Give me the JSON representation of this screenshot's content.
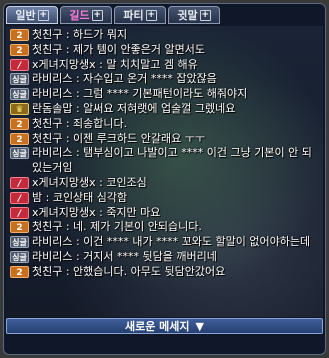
{
  "tabs": [
    {
      "label": "일반",
      "plus": "+"
    },
    {
      "label": "길드",
      "plus": "+"
    },
    {
      "label": "파티",
      "plus": "+"
    },
    {
      "label": "귓말",
      "plus": "+"
    }
  ],
  "messages": [
    {
      "badge": "2",
      "text": "첫친구 : 하드가 뭐지"
    },
    {
      "badge": "2",
      "text": "첫친구 : 제가 템이 안좋은거 알면서도"
    },
    {
      "badge": "/",
      "text": "x게녀지망생x : 말 치치말고 겜 해유"
    },
    {
      "badge": "싱글",
      "text": "라비리스 : 자수입고 온거 **** 잡았잖음"
    },
    {
      "badge": "싱글",
      "text": "라비리스 : 그럼 **** 기본패턴이라도 해줘야지"
    },
    {
      "badge": "♛",
      "text": "란돔솔맙 : 알써요 저혀랫에 업술껄 그렜네요"
    },
    {
      "badge": "2",
      "text": "첫친구 : 죄송합니다."
    },
    {
      "badge": "2",
      "text": "첫친구 : 이젠 루크하드 안갈래요 ㅜㅜ"
    },
    {
      "badge": "싱글",
      "text": "라비리스 : 탬부심이고 나발이고 **** 이건 그냥 기본이 안 되있는거임"
    },
    {
      "badge": "/",
      "text": "x게녀지망생x : 코인조심"
    },
    {
      "badge": "/",
      "text": "밤 : 코인상태 심각함"
    },
    {
      "badge": "/",
      "text": "x게녀지망생x : 죽지만 마요"
    },
    {
      "badge": "2",
      "text": "첫친구 : 네. 제가 기본이 안되습니다."
    },
    {
      "badge": "싱글",
      "text": "라비리스 : 이건 **** 내가 **** 꼬와도 할말이 없어야하는데"
    },
    {
      "badge": "싱글",
      "text": "라비리스 : 거지서 **** 뒷담을 깨버리네"
    },
    {
      "badge": "2",
      "text": "첫친구 : 안했습니다. 아무도 뒷담안갔어요"
    }
  ],
  "footer": {
    "label": "새로운 메세지",
    "arrow": "▼"
  }
}
